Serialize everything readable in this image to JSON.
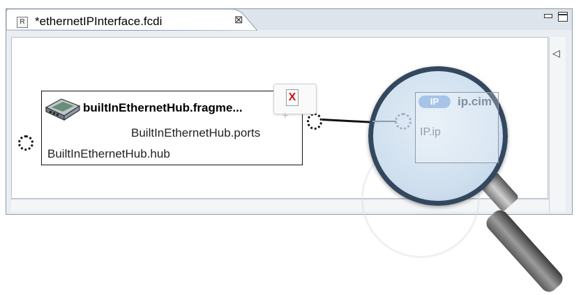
{
  "editor": {
    "tab_title": "*ethernetIPInterface.fcdi",
    "tab_close_glyph": "⊠",
    "file_icon_letter": "R"
  },
  "diagram": {
    "fragment_title": "builtInEthernetHub.fragme...",
    "ports_label": "BuiltInEthernetHub.ports",
    "hub_label": "BuiltInEthernetHub.hub",
    "delete_glyph": "X",
    "plus_glyph": "+"
  },
  "magnified": {
    "badge": "IP",
    "cim_label": "ip.cim",
    "ip_label": "IP.ip"
  },
  "icons": [
    "file-icon",
    "close-icon",
    "minimize-icon",
    "maximize-icon",
    "ethernet-hub-icon",
    "delete-icon",
    "plus-icon",
    "magnifier-icon",
    "scroll-left-arrow-icon"
  ],
  "colors": {
    "accent": "#a7c4e8",
    "delete": "#d01010",
    "lens_rim": "#33475e"
  }
}
